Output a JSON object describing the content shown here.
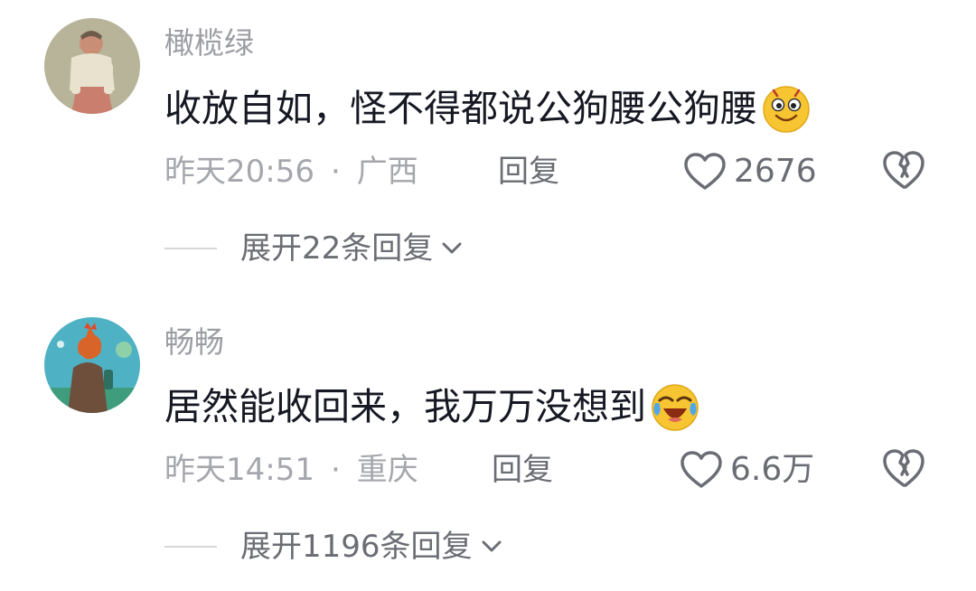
{
  "comments": [
    {
      "username": "橄榄绿",
      "text": "收放自如，怪不得都说公狗腰公狗腰",
      "emoji": "smiling-face-emoji",
      "time": "昨天20:56",
      "separator": "·",
      "location": "广西",
      "reply_label": "回复",
      "likes": "2676",
      "expand_label": "展开22条回复"
    },
    {
      "username": "畅畅",
      "text": "居然能收回来，我万万没想到",
      "emoji": "laugh-cry-emoji",
      "time": "昨天14:51",
      "separator": "·",
      "location": "重庆",
      "reply_label": "回复",
      "likes": "6.6万",
      "expand_label": "展开1196条回复"
    }
  ],
  "colors": {
    "name": "#9c9ea4",
    "text": "#161823",
    "meta": "#a5a7ad",
    "action": "#6b6d74",
    "emoji_yellow": "#f7c531"
  }
}
